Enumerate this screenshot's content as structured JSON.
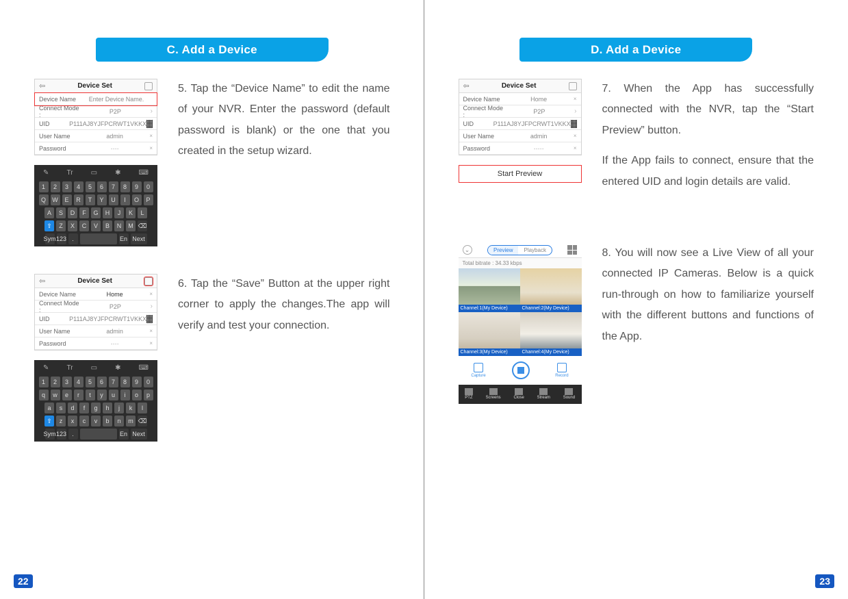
{
  "left": {
    "banner": "C. Add a Device",
    "page_num": "22",
    "step5": "5. Tap the “Device Name” to edit the name of your NVR. Enter the password (default password is blank) or the one that you created in the setup wizard.",
    "step6": "6. Tap the “Save” Button at the upper right corner to apply the changes.The app will verify and test your connection.",
    "phone5": {
      "title": "Device Set",
      "rows": {
        "deviceName": {
          "lbl": "Device Name",
          "val": "Enter Device Name."
        },
        "connectMode": {
          "lbl": "Connect Mode :",
          "val": "P2P"
        },
        "uid": {
          "lbl": "UID",
          "val": "P111AJ8YJFPCRWT1VKKX"
        },
        "userName": {
          "lbl": "User Name",
          "val": "admin"
        },
        "password": {
          "lbl": "Password",
          "val": "····"
        }
      }
    },
    "phone6": {
      "title": "Device Set",
      "rows": {
        "deviceName": {
          "lbl": "Device Name",
          "val": "Home"
        },
        "connectMode": {
          "lbl": "Connect Mode :",
          "val": "P2P"
        },
        "uid": {
          "lbl": "UID",
          "val": "P111AJ8YJFPCRWT1VKKX"
        },
        "userName": {
          "lbl": "User Name",
          "val": "admin"
        },
        "password": {
          "lbl": "Password",
          "val": "····"
        }
      }
    },
    "kbd_upper": {
      "r1": [
        "1",
        "2",
        "3",
        "4",
        "5",
        "6",
        "7",
        "8",
        "9",
        "0"
      ],
      "r2": [
        "Q",
        "W",
        "E",
        "R",
        "T",
        "Y",
        "U",
        "I",
        "O",
        "P"
      ],
      "r3": [
        "A",
        "S",
        "D",
        "F",
        "G",
        "H",
        "J",
        "K",
        "L"
      ],
      "r4": [
        "⇧",
        "Z",
        "X",
        "C",
        "V",
        "B",
        "N",
        "M",
        "⌫"
      ],
      "r5": [
        "Sym",
        "123",
        ".",
        "",
        "En",
        "Next"
      ]
    },
    "kbd_lower": {
      "r1": [
        "1",
        "2",
        "3",
        "4",
        "5",
        "6",
        "7",
        "8",
        "9",
        "0"
      ],
      "r2": [
        "q",
        "w",
        "e",
        "r",
        "t",
        "y",
        "u",
        "i",
        "o",
        "p"
      ],
      "r3": [
        "a",
        "s",
        "d",
        "f",
        "g",
        "h",
        "j",
        "k",
        "l"
      ],
      "r4": [
        "⇧",
        "z",
        "x",
        "c",
        "v",
        "b",
        "n",
        "m",
        "⌫"
      ],
      "r5": [
        "Sym",
        "123",
        ".",
        "",
        "En",
        "Next"
      ]
    }
  },
  "right": {
    "banner": "D. Add a Device",
    "page_num": "23",
    "step7a": "7. When the App has successfully connected with the NVR, tap the “Start Preview” button.",
    "step7b": "If the App fails to connect, ensure that the entered UID and login details are valid.",
    "step8": "8. You will now see a Live View of all your connected IP Cameras. Below is a quick run-through on how to familiarize yourself with the different buttons and functions of the App.",
    "phone7": {
      "title": "Device Set",
      "startPreview": "Start Preview",
      "rows": {
        "deviceName": {
          "lbl": "Device Name",
          "val": "Home"
        },
        "connectMode": {
          "lbl": "Connect Mode :",
          "val": "P2P"
        },
        "uid": {
          "lbl": "UID",
          "val": "P111AJ8YJFPCRWT1VKKX"
        },
        "userName": {
          "lbl": "User Name",
          "val": "admin"
        },
        "password": {
          "lbl": "Password",
          "val": "·····"
        }
      }
    },
    "live": {
      "segOn": "Preview",
      "segOff": "Playback",
      "bitrate": "Total bitrate : 34.33 kbps",
      "ch1": "Channel:1(My Device)",
      "ch2": "Channel:2(My Device)",
      "ch3": "Channel:3(My Device)",
      "ch4": "Channel:4(My Device)",
      "capture": "Capture",
      "record": "Record",
      "b1": "PTZ",
      "b2": "Screens",
      "b3": "Close",
      "b4": "Stream",
      "b5": "Sound"
    }
  }
}
